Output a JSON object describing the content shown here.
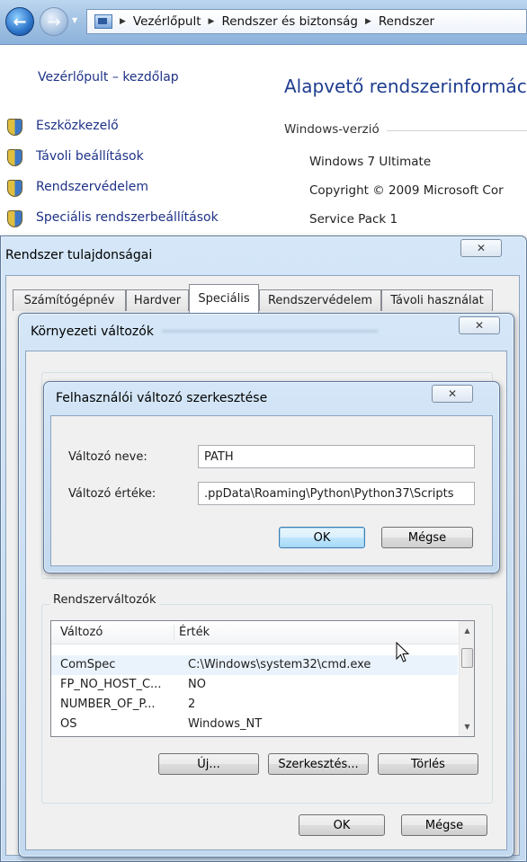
{
  "address_bar": {
    "breadcrumbs": [
      "Vezérlőpult",
      "Rendszer és biztonság",
      "Rendszer"
    ]
  },
  "control_panel": {
    "home_link": "Vezérlőpult – kezdőlap",
    "side_links": [
      "Eszközkezelő",
      "Távoli beállítások",
      "Rendszervédelem",
      "Speciális rendszerbeállítások"
    ],
    "title": "Alapvető rendszerinformáci",
    "section": "Windows-verzió",
    "edition": "Windows 7 Ultimate",
    "copyright": "Copyright © 2009 Microsoft Cor",
    "service_pack": "Service Pack 1"
  },
  "system_properties": {
    "title": "Rendszer tulajdonságai",
    "close_glyph": "✕",
    "tabs": [
      "Számítógépnév",
      "Hardver",
      "Speciális",
      "Rendszervédelem",
      "Távoli használat"
    ],
    "active_tab": "Speciális"
  },
  "env_dialog": {
    "title": "Környezeti változók",
    "close_glyph": "✕",
    "system_group_label": "Rendszerváltozók",
    "columns": [
      "Változó",
      "Érték"
    ],
    "rows": [
      {
        "name": "ComSpec",
        "value": "C:\\Windows\\system32\\cmd.exe"
      },
      {
        "name": "FP_NO_HOST_C...",
        "value": "NO"
      },
      {
        "name": "NUMBER_OF_P...",
        "value": "2"
      },
      {
        "name": "OS",
        "value": "Windows_NT"
      }
    ],
    "new_label": "Új...",
    "edit_label": "Szerkesztés...",
    "delete_label": "Törlés",
    "ok_label": "OK",
    "cancel_label": "Mégse"
  },
  "edit_dialog": {
    "title": "Felhasználói változó szerkesztése",
    "close_glyph": "✕",
    "name_label": "Változó neve:",
    "name_value": "PATH",
    "value_label": "Változó értéke:",
    "value_value": ".ppData\\Roaming\\Python\\Python37\\Scripts",
    "ok_label": "OK",
    "cancel_label": "Mégse"
  },
  "colors": {
    "link": "#1e3287",
    "title_blue": "#1e3d8f",
    "frame": "#c3d9ef",
    "dialog_bg": "#f0f0f0"
  }
}
